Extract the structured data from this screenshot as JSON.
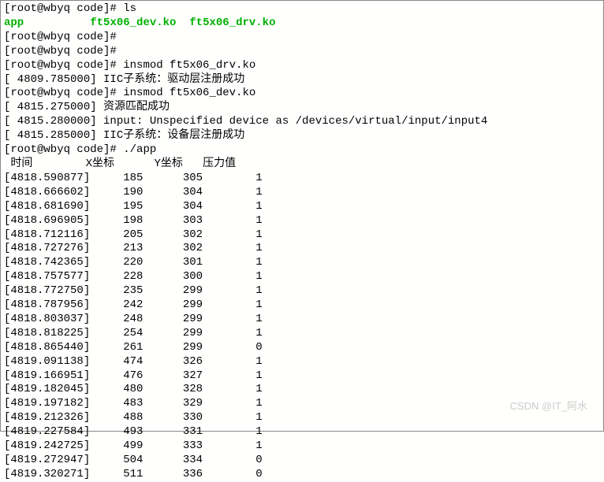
{
  "prompt": "[root@wbyq code]# ",
  "cmds": {
    "ls": "ls",
    "insmod_drv": "insmod ft5x06_drv.ko",
    "insmod_dev": "insmod ft5x06_dev.ko",
    "run_app": "./app"
  },
  "ls_output": {
    "col1": "app",
    "col2": "ft5x06_dev.ko",
    "col3": "ft5x06_drv.ko"
  },
  "msgs": {
    "drv_reg": "[ 4809.785000] IIC子系统：驱动层注册成功",
    "res_match": "[ 4815.275000] 资源匹配成功",
    "input_dev": "[ 4815.280000] input: Unspecified device as /devices/virtual/input/input4",
    "dev_reg": "[ 4815.285000] IIC子系统：设备层注册成功"
  },
  "table_header": {
    "time": " 时间",
    "x": "X坐标",
    "y": "Y坐标",
    "p": "压力值"
  },
  "rows": [
    {
      "t": "[4818.590877]",
      "x": "185",
      "y": "305",
      "p": "1"
    },
    {
      "t": "[4818.666602]",
      "x": "190",
      "y": "304",
      "p": "1"
    },
    {
      "t": "[4818.681690]",
      "x": "195",
      "y": "304",
      "p": "1"
    },
    {
      "t": "[4818.696905]",
      "x": "198",
      "y": "303",
      "p": "1"
    },
    {
      "t": "[4818.712116]",
      "x": "205",
      "y": "302",
      "p": "1"
    },
    {
      "t": "[4818.727276]",
      "x": "213",
      "y": "302",
      "p": "1"
    },
    {
      "t": "[4818.742365]",
      "x": "220",
      "y": "301",
      "p": "1"
    },
    {
      "t": "[4818.757577]",
      "x": "228",
      "y": "300",
      "p": "1"
    },
    {
      "t": "[4818.772750]",
      "x": "235",
      "y": "299",
      "p": "1"
    },
    {
      "t": "[4818.787956]",
      "x": "242",
      "y": "299",
      "p": "1"
    },
    {
      "t": "[4818.803037]",
      "x": "248",
      "y": "299",
      "p": "1"
    },
    {
      "t": "[4818.818225]",
      "x": "254",
      "y": "299",
      "p": "1"
    },
    {
      "t": "[4818.865440]",
      "x": "261",
      "y": "299",
      "p": "0"
    },
    {
      "t": "[4819.091138]",
      "x": "474",
      "y": "326",
      "p": "1"
    },
    {
      "t": "[4819.166951]",
      "x": "476",
      "y": "327",
      "p": "1"
    },
    {
      "t": "[4819.182045]",
      "x": "480",
      "y": "328",
      "p": "1"
    },
    {
      "t": "[4819.197182]",
      "x": "483",
      "y": "329",
      "p": "1"
    },
    {
      "t": "[4819.212326]",
      "x": "488",
      "y": "330",
      "p": "1"
    },
    {
      "t": "[4819.227584]",
      "x": "493",
      "y": "331",
      "p": "1"
    },
    {
      "t": "[4819.242725]",
      "x": "499",
      "y": "333",
      "p": "1"
    },
    {
      "t": "[4819.272947]",
      "x": "504",
      "y": "334",
      "p": "0"
    },
    {
      "t": "[4819.320271]",
      "x": "511",
      "y": "336",
      "p": "0"
    }
  ],
  "watermark": "CSDN @IT_阿水"
}
